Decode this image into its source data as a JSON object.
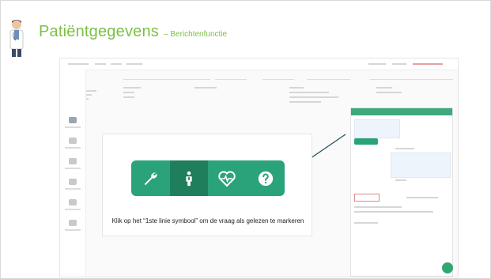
{
  "slide": {
    "title": "Patiëntgegevens",
    "subtitle": "– Berichtenfunctie"
  },
  "callout": {
    "text": "Klik op het “1ste linie symbool”  om de vraag als gelezen te markeren",
    "buttons": [
      {
        "icon": "wrench-icon",
        "active": false
      },
      {
        "icon": "person-icon",
        "active": true
      },
      {
        "icon": "heart-pulse-icon",
        "active": false
      },
      {
        "icon": "question-icon",
        "active": false
      }
    ]
  },
  "colors": {
    "title_green": "#7ac143",
    "button_green": "#2aa37a",
    "button_active": "#1f7f5c",
    "arrow": "#1f4e5a"
  }
}
